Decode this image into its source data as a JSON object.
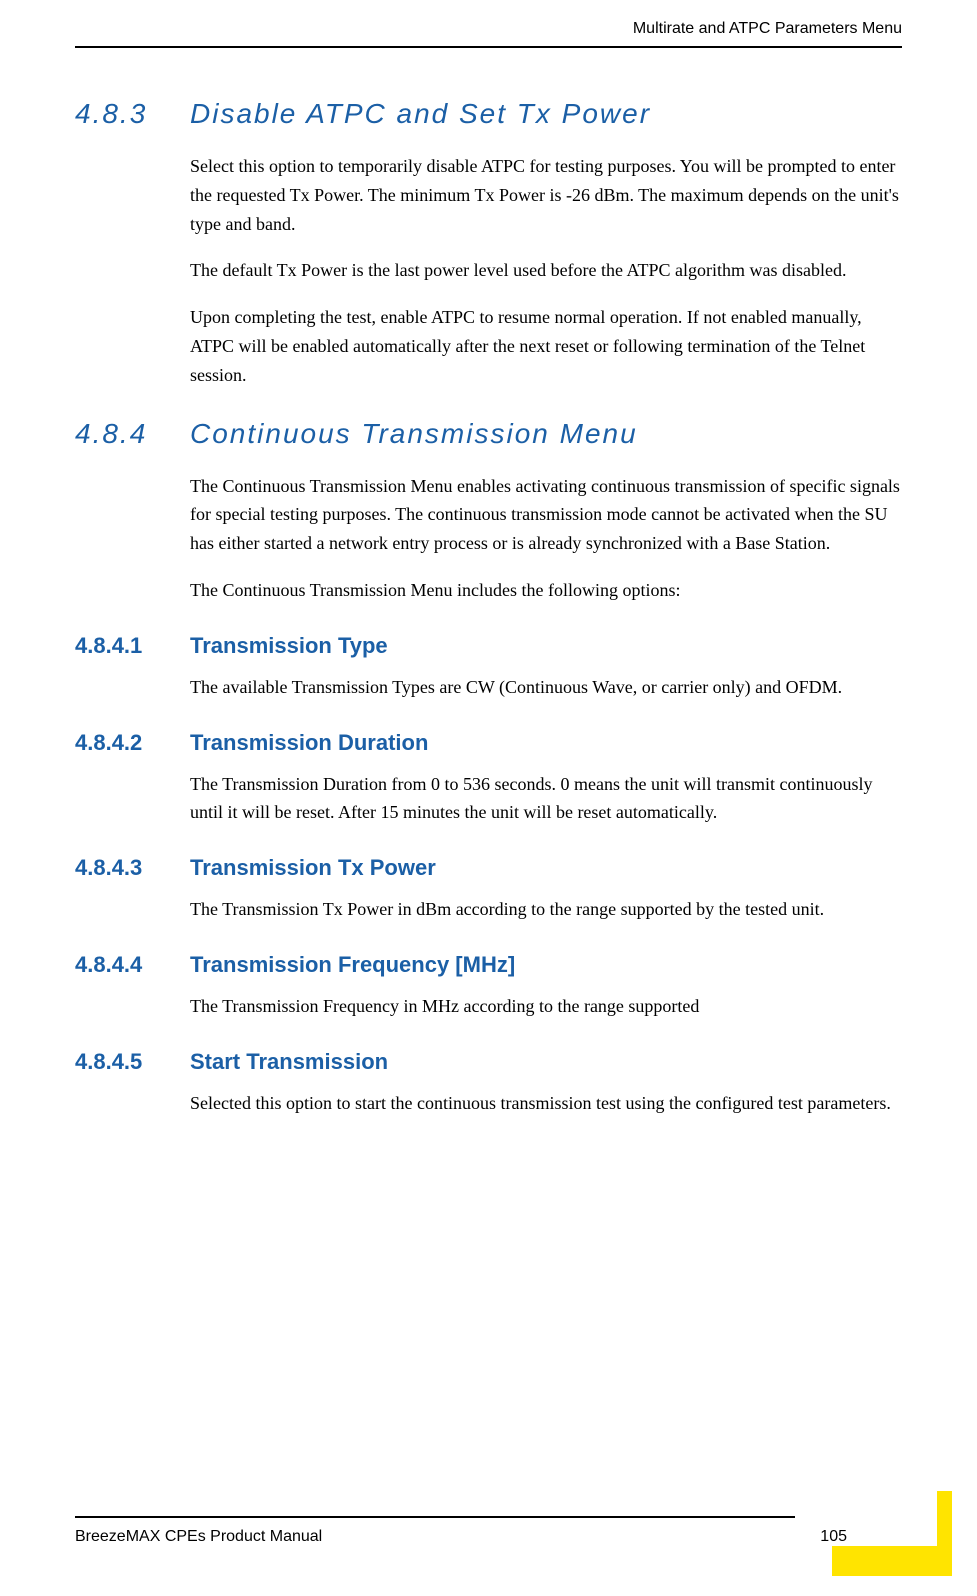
{
  "header": {
    "text": "Multirate and ATPC Parameters Menu"
  },
  "sections": [
    {
      "type": "major",
      "number": "4.8.3",
      "title": "Disable ATPC and Set Tx Power",
      "paragraphs": [
        "Select this option to temporarily disable ATPC for testing purposes. You will be prompted to enter the requested Tx Power. The minimum Tx Power is -26 dBm. The maximum depends on the unit's type and band.",
        "The default Tx Power is the last power level used before the ATPC algorithm was disabled.",
        "Upon completing the test, enable ATPC to resume normal operation. If not enabled manually, ATPC will be enabled automatically after the next reset or following termination of the Telnet session."
      ]
    },
    {
      "type": "major",
      "number": "4.8.4",
      "title": "Continuous Transmission Menu",
      "paragraphs": [
        "The Continuous Transmission Menu enables activating continuous transmission of specific signals for special testing purposes. The continuous transmission mode cannot be activated when the SU has either started a network entry process or is already synchronized with a Base Station.",
        "The Continuous Transmission Menu includes the following options:"
      ]
    },
    {
      "type": "minor",
      "number": "4.8.4.1",
      "title": "Transmission Type",
      "paragraphs": [
        "The available Transmission Types are CW (Continuous Wave, or carrier only) and OFDM."
      ]
    },
    {
      "type": "minor",
      "number": "4.8.4.2",
      "title": "Transmission Duration",
      "paragraphs": [
        "The Transmission Duration from 0 to 536 seconds. 0 means the unit will transmit continuously until it will be reset. After 15 minutes the unit will be reset automatically."
      ]
    },
    {
      "type": "minor",
      "number": "4.8.4.3",
      "title": "Transmission Tx Power",
      "paragraphs": [
        "The Transmission Tx Power in dBm according to the range supported by the tested unit."
      ]
    },
    {
      "type": "minor",
      "number": "4.8.4.4",
      "title": "Transmission Frequency [MHz]",
      "paragraphs": [
        "The Transmission Frequency in MHz according to the range supported"
      ]
    },
    {
      "type": "minor",
      "number": "4.8.4.5",
      "title": "Start Transmission",
      "paragraphs": [
        "Selected this option to start the continuous transmission test using the configured test parameters."
      ]
    }
  ],
  "footer": {
    "left": "BreezeMAX CPEs Product Manual",
    "page": "105"
  }
}
